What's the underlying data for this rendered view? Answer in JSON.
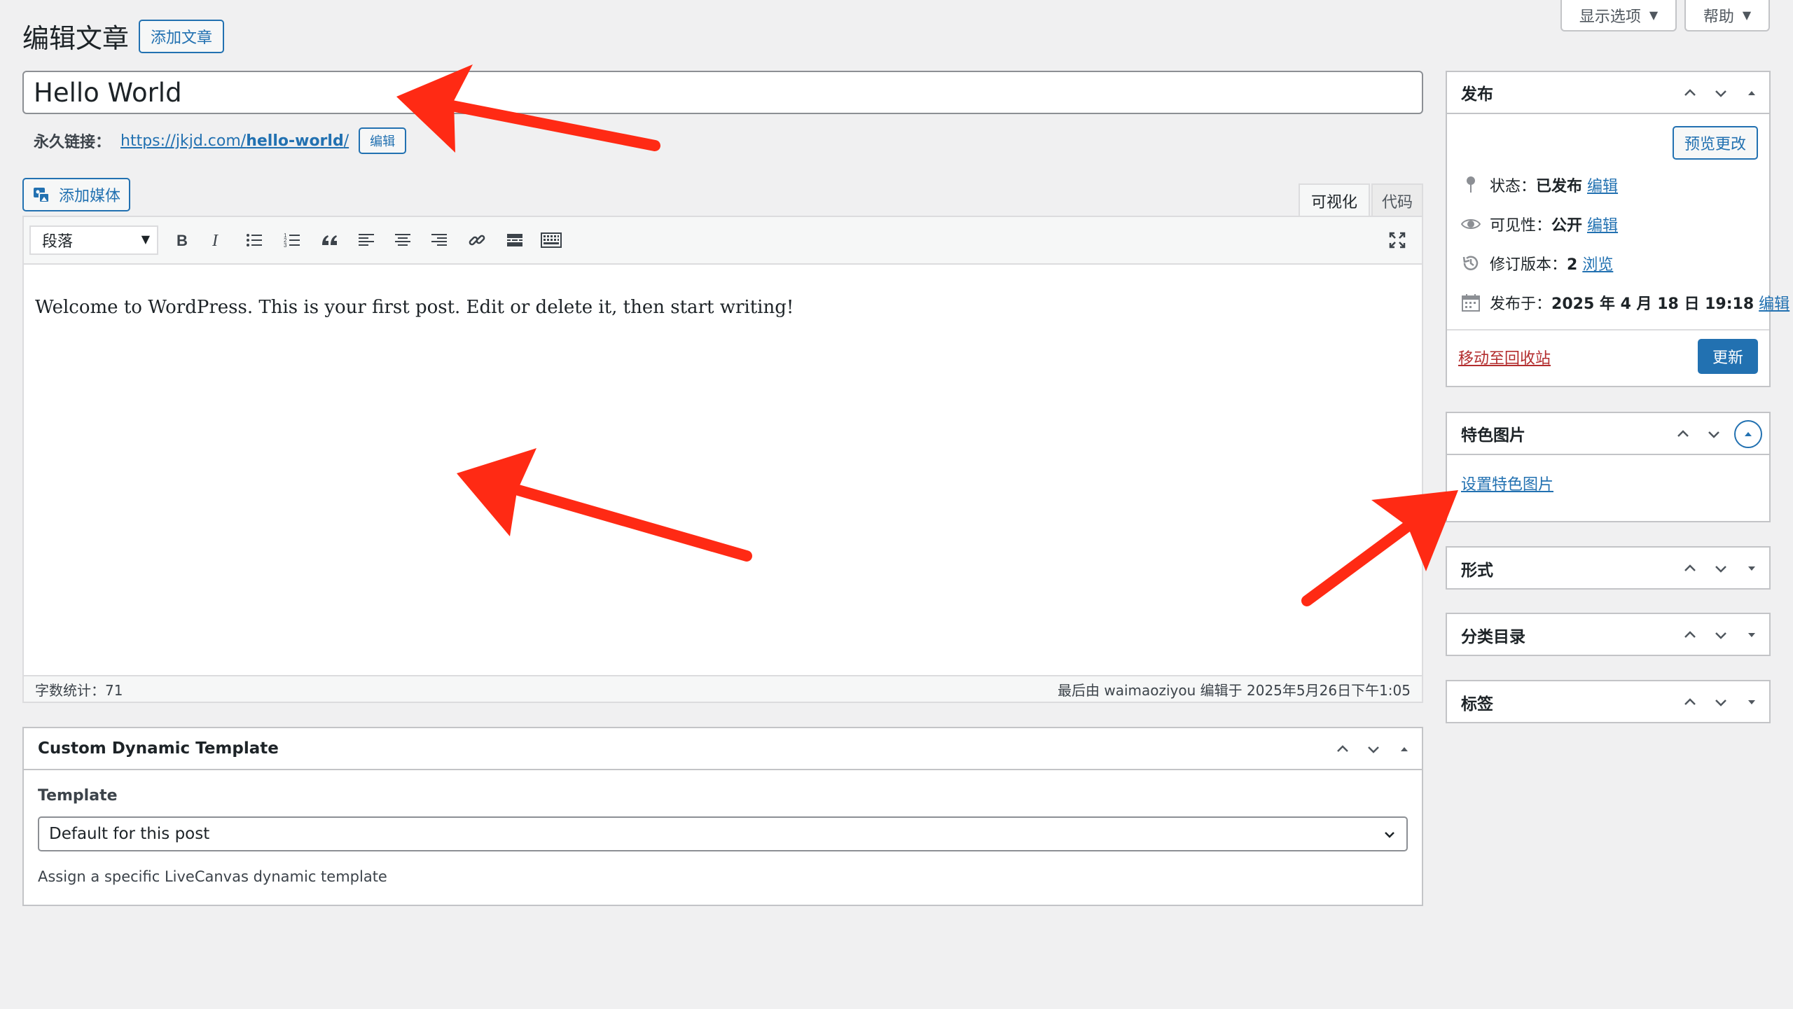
{
  "header": {
    "page_title": "编辑文章",
    "add_new_label": "添加文章",
    "screen_options_label": "显示选项",
    "help_label": "帮助"
  },
  "post": {
    "title": "Hello World",
    "permalink_label": "永久链接：",
    "permalink_base": "https://jkjd.com/",
    "permalink_slug": "hello-world",
    "permalink_trailing": "/",
    "permalink_edit_label": "编辑"
  },
  "editor": {
    "add_media_label": "添加媒体",
    "tab_visual": "可视化",
    "tab_code": "代码",
    "format_select": "段落",
    "toolbar_icons": [
      "bold-icon",
      "italic-icon",
      "bullet-list-icon",
      "numbered-list-icon",
      "blockquote-icon",
      "align-left-icon",
      "align-center-icon",
      "align-right-icon",
      "link-icon",
      "read-more-icon",
      "toolbar-toggle-icon",
      "fullscreen-icon"
    ],
    "content": "Welcome to WordPress. This is your first post. Edit or delete it, then start writing!",
    "word_count": "字数统计：71",
    "last_edited": "最后由 waimaoziyou 编辑于 2025年5月26日下午1:05"
  },
  "custom_template": {
    "title": "Custom Dynamic Template",
    "field_label": "Template",
    "selected": "Default for this post",
    "description": "Assign a specific LiveCanvas dynamic template"
  },
  "publish_box": {
    "title": "发布",
    "preview_label": "预览更改",
    "status_label": "状态：",
    "status_value": "已发布",
    "visibility_label": "可见性：",
    "visibility_value": "公开",
    "revisions_label": "修订版本：",
    "revisions_value": "2",
    "browse_label": "浏览",
    "published_label": "发布于：",
    "published_value": "2025 年 4 月 18 日 19:18",
    "edit_label": "编辑",
    "trash_label": "移动至回收站",
    "update_label": "更新"
  },
  "featured_image": {
    "title": "特色图片",
    "set_label": "设置特色图片"
  },
  "format_box": {
    "title": "形式"
  },
  "categories_box": {
    "title": "分类目录"
  },
  "tags_box": {
    "title": "标签"
  },
  "colors": {
    "accent": "#2271b1",
    "annotation_arrow": "#ff2a14",
    "trash": "#b32d2e"
  }
}
